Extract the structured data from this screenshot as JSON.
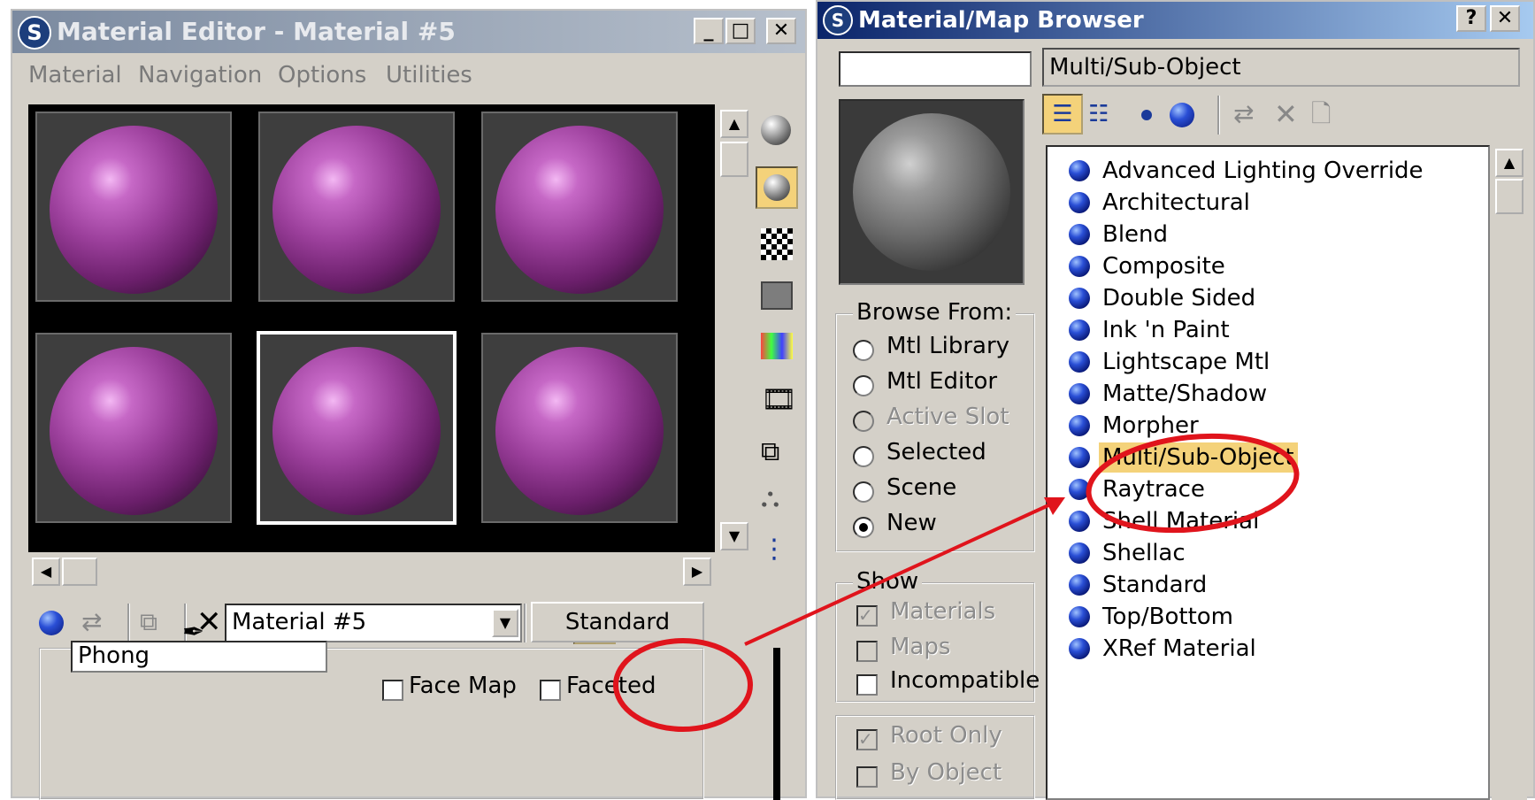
{
  "material_editor": {
    "title": "Material Editor - Material #5",
    "menu": [
      "Material",
      "Navigation",
      "Options",
      "Utilities"
    ],
    "material_name": "Material #5",
    "type_button": "Standard",
    "shader": "Phong",
    "face_map_label": "Face Map",
    "faceted_label": "Faceted"
  },
  "browser": {
    "title": "Material/Map Browser",
    "search_value": "",
    "current_type": "Multi/Sub-Object",
    "browse_from": {
      "title": "Browse From:",
      "options": [
        "Mtl Library",
        "Mtl Editor",
        "Active Slot",
        "Selected",
        "Scene",
        "New"
      ],
      "selected": "New"
    },
    "show": {
      "title": "Show",
      "materials": "Materials",
      "maps": "Maps",
      "incompatible": "Incompatible",
      "root_only": "Root Only",
      "by_object": "By Object"
    },
    "items": [
      "Advanced Lighting Override",
      "Architectural",
      "Blend",
      "Composite",
      "Double Sided",
      "Ink 'n Paint",
      "Lightscape Mtl",
      "Matte/Shadow",
      "Morpher",
      "Multi/Sub-Object",
      "Raytrace",
      "Shell Material",
      "Shellac",
      "Standard",
      "Top/Bottom",
      "XRef Material"
    ],
    "highlighted_item": "Multi/Sub-Object"
  },
  "colors": {
    "annotation": "#e0141c",
    "highlight": "#f4d27a",
    "slot_sphere": "#9b3f9b"
  }
}
